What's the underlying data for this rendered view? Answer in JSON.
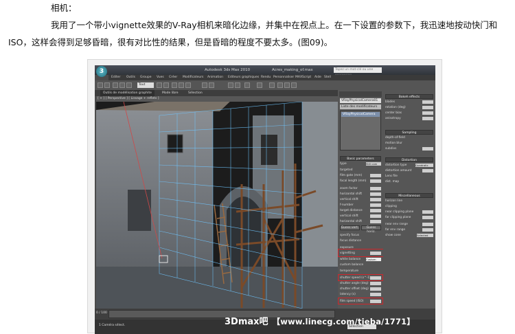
{
  "article": {
    "heading": "相机：",
    "line1": "我用了一个带小vignette效果的V-Ray相机来暗化边缘，并集中在视点上。在一下设置的参数下，我迅速地按动快门和",
    "line2": "ISO，这样会得到足够昏暗，很有对比性的结果，但是昏暗的程度不要太多。(图09)。"
  },
  "app": {
    "title": "Autodesk 3ds Max 2010",
    "file": "Acres_making_of.max",
    "search_placeholder": "Tapez un mot-clé ou une expression",
    "menus": [
      "Editer",
      "Outils",
      "Groupe",
      "Vues",
      "Créer",
      "Modificateurs",
      "Animation",
      "Editeurs graphiques",
      "Rendu",
      "Personnaliser",
      "MAXScript",
      "Aide",
      "Stell"
    ],
    "toolbar_dropdown": "Tout",
    "ribbon_tabs": [
      "Outils de modélisation graphite",
      "Mode libre",
      "Sélection"
    ],
    "viewport_label": "[ + ] [ Perspective ] [ Lissage + reflets ]",
    "modifier_name": "VRayPhysicalCamera01",
    "modifier_list": "Liste des modificateurs",
    "modifier_item": "VRayPhysicalCamera",
    "basic_params": "Basic parameters",
    "basic_rows": [
      "type",
      "targeted",
      "film gate (mm)",
      "focal length (mm)",
      "zoom factor",
      "horizontal shift",
      "vertical shift",
      "f-number",
      "target distance",
      "vertical shift",
      "horizontal shift",
      "guess vert.",
      "specify focus",
      "focus distance",
      "exposure",
      "vignetting",
      "white balance",
      "custom balance",
      "temperature",
      "shutter speed (s^-1)",
      "shutter angle (deg)",
      "shutter offset (deg)",
      "latency (s)",
      "film speed (ISO)"
    ],
    "type_value": "Still cam",
    "wb_value": "Custom",
    "guess_buttons": [
      "Guess vert.",
      "Guess horiz."
    ],
    "bokeh": "Bokeh effects",
    "bokeh_rows": [
      "blades",
      "rotation (deg)",
      "center bias",
      "anisotropy"
    ],
    "sampling": "Sampling",
    "sampling_rows": [
      "depth-of-field",
      "motion blur",
      "subdivs"
    ],
    "distortion": "Distortion",
    "distortion_rows": [
      "distortion type",
      "distortion amount",
      "Lens file"
    ],
    "distortion_value": "Quadratic",
    "dist_map": "dist. map",
    "misc": "Miscellaneous",
    "misc_rows": [
      "horizon line",
      "clipping",
      "near clipping plane",
      "far clipping plane",
      "near env range",
      "far env range",
      "show cone"
    ],
    "show_cone_value": "Selected",
    "frame_counter": "0 / 100",
    "status": "1 Caméra sélect.",
    "status_select": "Sélection"
  },
  "watermark": {
    "brand": "3Dmax吧",
    "url": "【www.linecg.com/tieba/1771】"
  },
  "colors": {
    "highlight": "#d2262b",
    "sky": "#1c1c1c"
  }
}
